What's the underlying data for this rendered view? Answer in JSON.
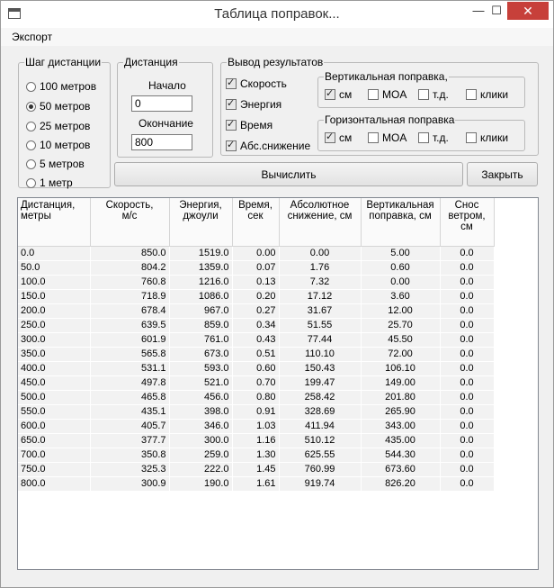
{
  "window": {
    "title": "Таблица поправок...",
    "minimize": "—",
    "maximize": "☐",
    "close": "✕"
  },
  "menu": {
    "export": "Экспорт"
  },
  "step_group": {
    "legend": "Шаг дистанции",
    "options": [
      "100 метров",
      "50 метров",
      "25 метров",
      "10 метров",
      "5 метров",
      "1 метр"
    ],
    "selected": "50 метров"
  },
  "distance_group": {
    "legend": "Дистанция",
    "start_label": "Начало",
    "start_value": "0",
    "end_label": "Окончание",
    "end_value": "800"
  },
  "output_group": {
    "legend": "Вывод результатов",
    "speed": "Скорость",
    "energy": "Энергия",
    "time": "Время",
    "abs_drop": "Абс.снижение"
  },
  "vertical_group": {
    "legend": "Вертикальная поправка,",
    "cm": "см",
    "moa": "MOA",
    "td": "т.д.",
    "clicks": "клики"
  },
  "horizontal_group": {
    "legend": "Горизонтальная поправка",
    "cm": "см",
    "moa": "MOA",
    "td": "т.д.",
    "clicks": "клики"
  },
  "buttons": {
    "calculate": "Вычислить",
    "close": "Закрыть"
  },
  "table": {
    "headers": [
      [
        "Дистанция,",
        "метры"
      ],
      [
        "Скорость,",
        "м/с"
      ],
      [
        "Энергия,",
        "джоули"
      ],
      [
        "Время,",
        "сек"
      ],
      [
        "Абсолютное",
        "снижение, см"
      ],
      [
        "Вертикальная",
        "поправка, см"
      ],
      [
        "Снос",
        "ветром,",
        "см"
      ]
    ],
    "rows": [
      [
        "0.0",
        "850.0",
        "1519.0",
        "0.00",
        "0.00",
        "5.00",
        "0.0"
      ],
      [
        "50.0",
        "804.2",
        "1359.0",
        "0.07",
        "1.76",
        "0.60",
        "0.0"
      ],
      [
        "100.0",
        "760.8",
        "1216.0",
        "0.13",
        "7.32",
        "0.00",
        "0.0"
      ],
      [
        "150.0",
        "718.9",
        "1086.0",
        "0.20",
        "17.12",
        "3.60",
        "0.0"
      ],
      [
        "200.0",
        "678.4",
        "967.0",
        "0.27",
        "31.67",
        "12.00",
        "0.0"
      ],
      [
        "250.0",
        "639.5",
        "859.0",
        "0.34",
        "51.55",
        "25.70",
        "0.0"
      ],
      [
        "300.0",
        "601.9",
        "761.0",
        "0.43",
        "77.44",
        "45.50",
        "0.0"
      ],
      [
        "350.0",
        "565.8",
        "673.0",
        "0.51",
        "110.10",
        "72.00",
        "0.0"
      ],
      [
        "400.0",
        "531.1",
        "593.0",
        "0.60",
        "150.43",
        "106.10",
        "0.0"
      ],
      [
        "450.0",
        "497.8",
        "521.0",
        "0.70",
        "199.47",
        "149.00",
        "0.0"
      ],
      [
        "500.0",
        "465.8",
        "456.0",
        "0.80",
        "258.42",
        "201.80",
        "0.0"
      ],
      [
        "550.0",
        "435.1",
        "398.0",
        "0.91",
        "328.69",
        "265.90",
        "0.0"
      ],
      [
        "600.0",
        "405.7",
        "346.0",
        "1.03",
        "411.94",
        "343.00",
        "0.0"
      ],
      [
        "650.0",
        "377.7",
        "300.0",
        "1.16",
        "510.12",
        "435.00",
        "0.0"
      ],
      [
        "700.0",
        "350.8",
        "259.0",
        "1.30",
        "625.55",
        "544.30",
        "0.0"
      ],
      [
        "750.0",
        "325.3",
        "222.0",
        "1.45",
        "760.99",
        "673.60",
        "0.0"
      ],
      [
        "800.0",
        "300.9",
        "190.0",
        "1.61",
        "919.74",
        "826.20",
        "0.0"
      ]
    ]
  }
}
